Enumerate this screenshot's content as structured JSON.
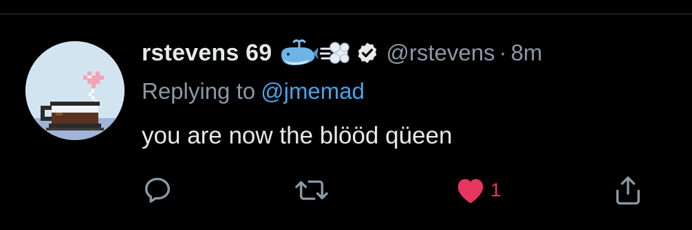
{
  "tweet": {
    "display_name": "rstevens 69",
    "name_emojis": [
      "spouting-whale-emoji",
      "dash-emoji"
    ],
    "verified_icon": "verified-badge-icon",
    "handle": "@rstevens",
    "separator": "·",
    "time": "8m",
    "replying_prefix": "Replying to",
    "replying_handle": "@jmemad",
    "text": "you are now the blööd qüeen"
  },
  "actions": {
    "reply": {
      "icon": "reply-icon"
    },
    "retweet": {
      "icon": "retweet-icon"
    },
    "like": {
      "icon": "heart-icon",
      "count": "1",
      "liked": true
    },
    "share": {
      "icon": "share-icon"
    }
  },
  "colors": {
    "background": "#000000",
    "text": "#e7e9ea",
    "muted": "#8b98a5",
    "link": "#4aa3e8",
    "like": "#e6365f",
    "divider": "#2f3336"
  }
}
